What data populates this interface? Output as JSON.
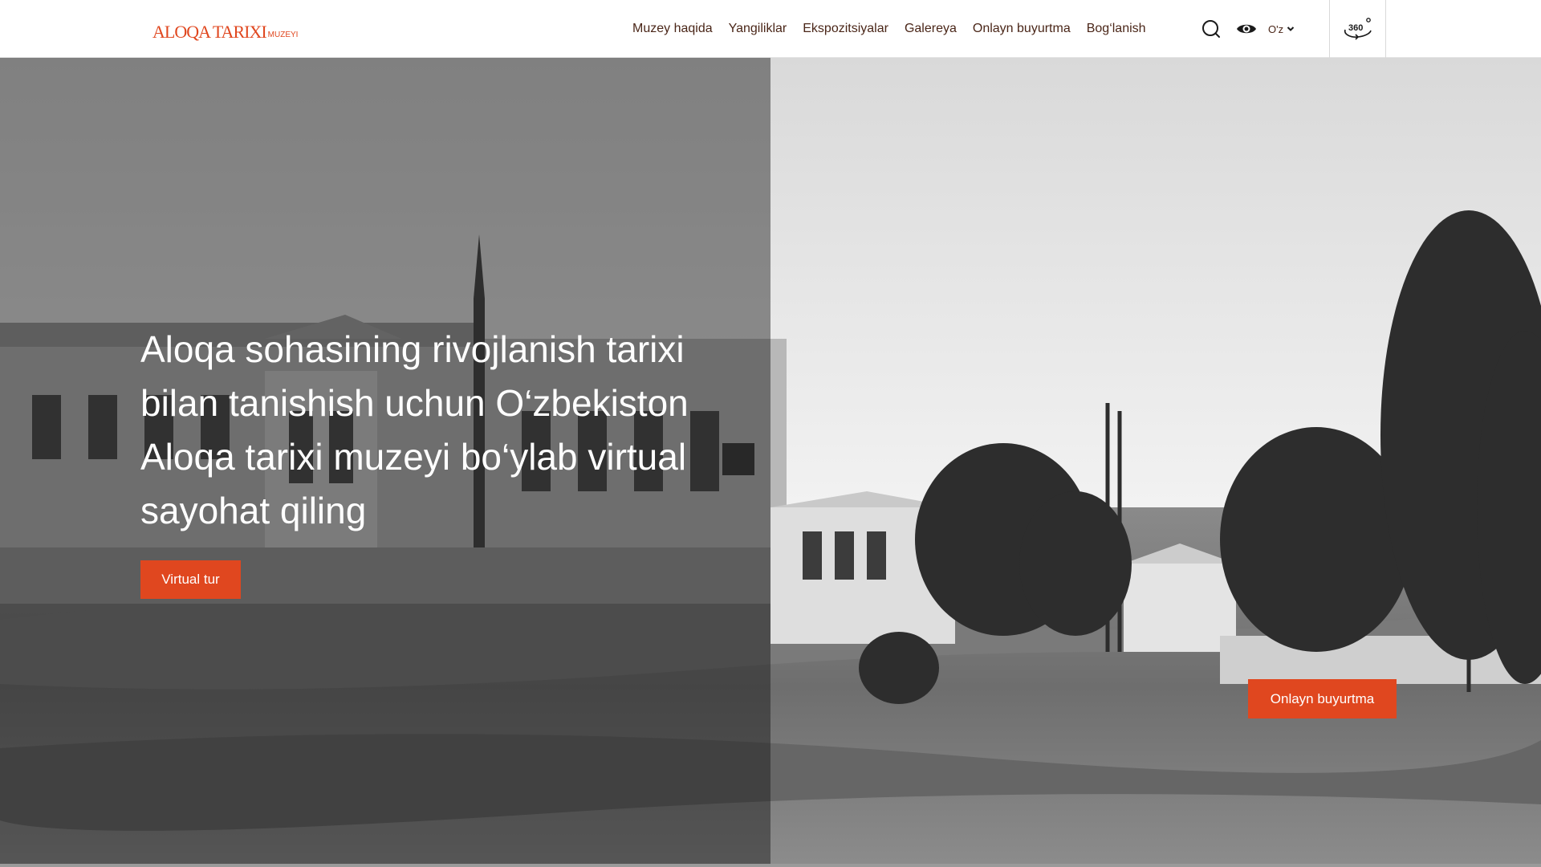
{
  "header": {
    "logo_main": "ALOQA TARIXI",
    "logo_sub": "MUZEYI",
    "nav": [
      {
        "label": "Muzey haqida"
      },
      {
        "label": "Yangiliklar"
      },
      {
        "label": "Ekspozitsiyalar"
      },
      {
        "label": "Galereya"
      },
      {
        "label": "Onlayn buyurtma"
      },
      {
        "label": "Bog‘lanish"
      }
    ],
    "language": "O'z",
    "tour_label": "360",
    "icons": [
      "search-icon",
      "eye-icon",
      "chevron-down-icon",
      "tour-360-icon"
    ]
  },
  "hero": {
    "title": "Aloqa sohasining rivojlanish tarixi bilan tanishish uchun O‘zbekiston Aloqa tarixi muzeyi bo‘ylab virtual sayohat qiling",
    "virtual_button": "Virtual tur",
    "order_button": "Onlayn buyurtma"
  },
  "colors": {
    "accent": "#e0471f",
    "nav_text": "#4a2618",
    "header_bg": "#ffffff"
  }
}
